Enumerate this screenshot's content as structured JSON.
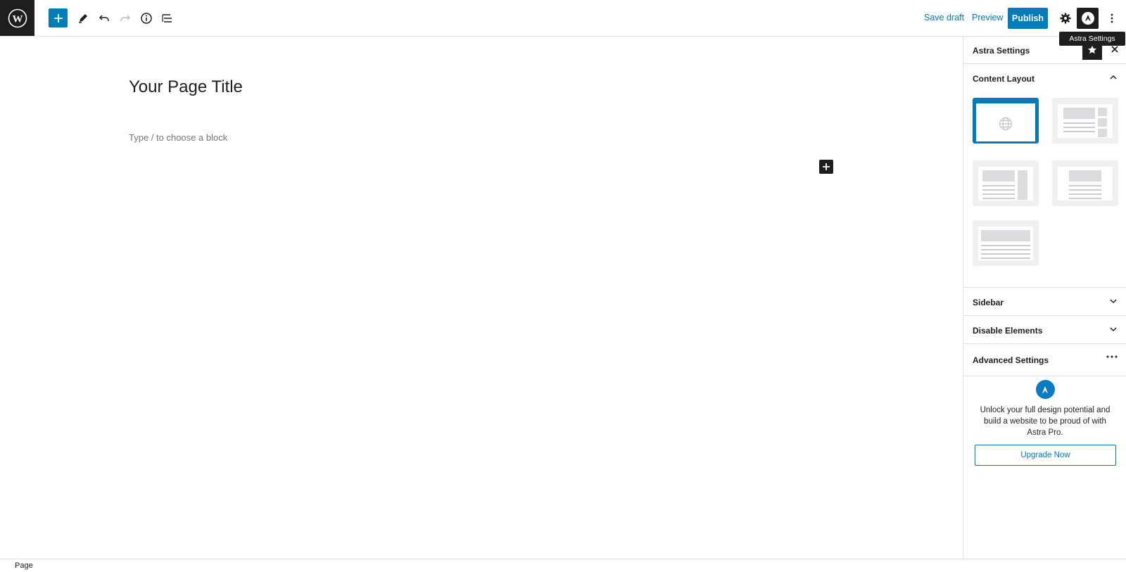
{
  "toolbar": {
    "wp_logo_icon": "wordpress-icon",
    "add_block_icon": "plus-icon",
    "tools_icon": "pencil-icon",
    "undo_icon": "undo-icon",
    "redo_icon": "redo-icon",
    "details_icon": "info-icon",
    "list_view_icon": "list-view-icon",
    "save_draft_label": "Save draft",
    "preview_label": "Preview",
    "publish_label": "Publish",
    "settings_icon": "gear-icon",
    "astra_icon": "astra-logo-icon",
    "more_icon": "more-vertical-icon",
    "tooltip": "Astra Settings"
  },
  "editor": {
    "title": "Your Page Title",
    "placeholder": "Type / to choose a block"
  },
  "sidebar": {
    "title": "Astra Settings",
    "panels": {
      "content_layout": "Content Layout",
      "sidebar": "Sidebar",
      "disable_elements": "Disable Elements",
      "advanced_settings": "Advanced Settings"
    },
    "promo": {
      "text": "Unlock your full design potential and build a website to be proud of with Astra Pro.",
      "button": "Upgrade Now"
    }
  },
  "footer": {
    "breadcrumb": "Page"
  },
  "colors": {
    "accent": "#007cba",
    "dark": "#1e1e1e",
    "border": "#e0e0e0"
  }
}
